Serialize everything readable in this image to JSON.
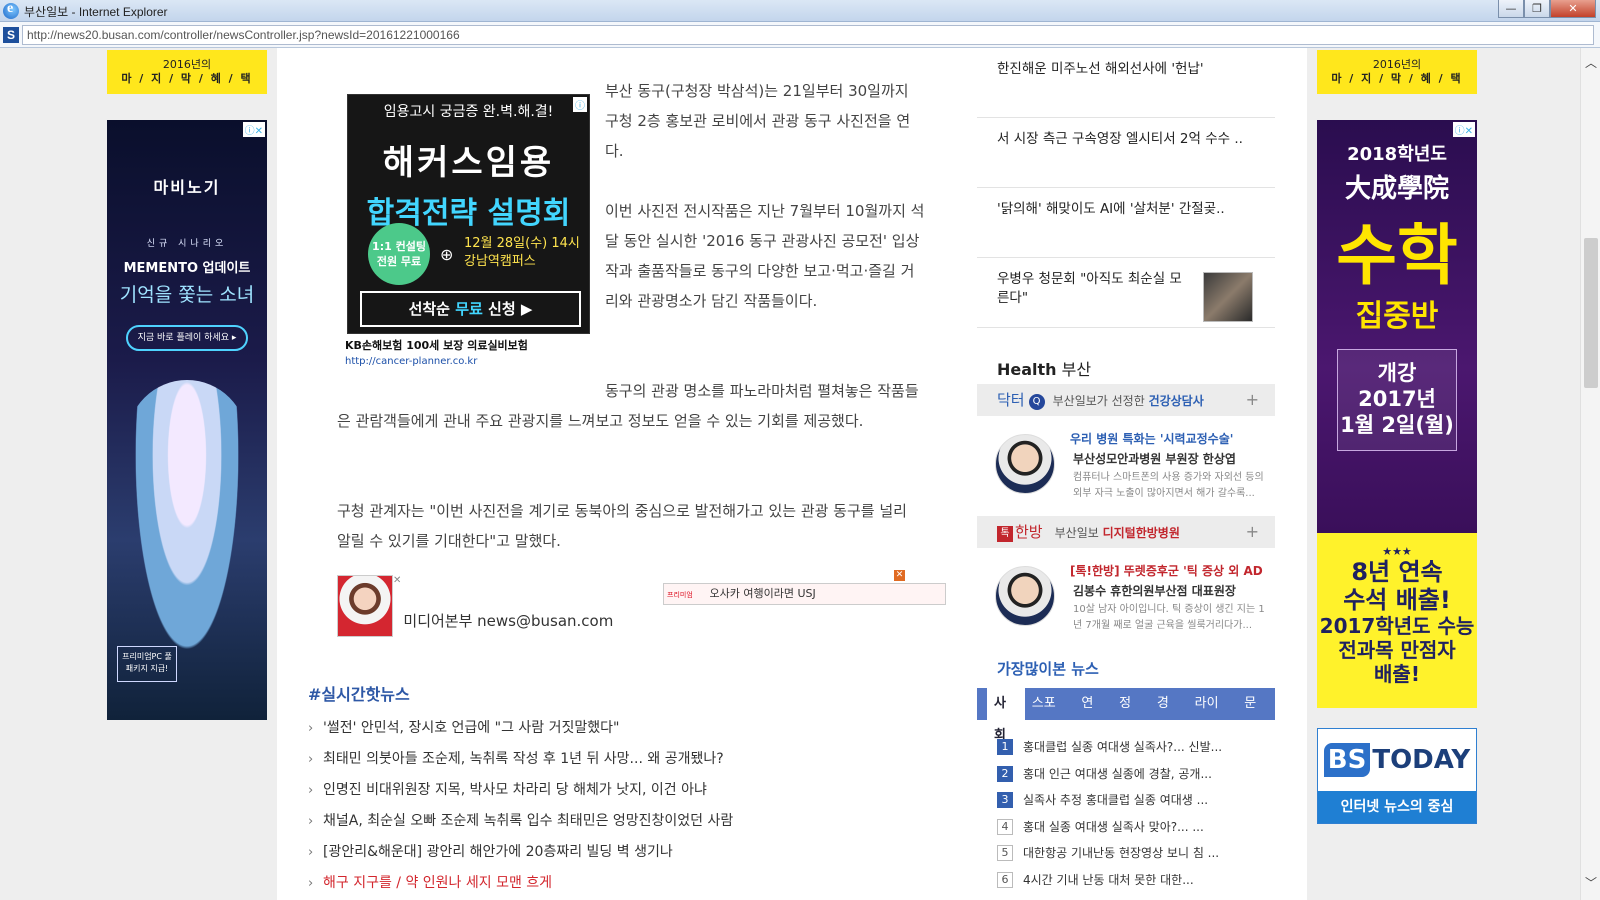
{
  "window": {
    "title": "부산일보 - Internet Explorer",
    "url": "http://news20.busan.com/controller/newsController.jsp?newsId=20161221000166",
    "buttons": {
      "minimize": "—",
      "maximize": "❐",
      "close": "✕"
    }
  },
  "side_banner": {
    "line1": "2016년의",
    "line2": "마 / 지 / 막 / 혜 / 택"
  },
  "ad_left": {
    "logo": "마비노기",
    "line1": "신규 시나리오",
    "line2": "MEMENTO 업데이트",
    "line3": "기억을 쫓는 소녀",
    "button": "지금 바로 플레이 하세요 ▸",
    "pc": "프리미엄PC 풀 패키지 지급!"
  },
  "ad_right": {
    "year": "2018학년도",
    "brand": "大成學院",
    "big": "수학",
    "sub": "집중반",
    "box": [
      "개강",
      "2017년",
      "1월 2일(월)"
    ],
    "stars": "★★★",
    "promo1": "8년 연속",
    "promo2": "수석 배출!",
    "promo3": "2017학년도 수능",
    "promo4": "전과목 만점자",
    "promo5": "배출!"
  },
  "bstoday": {
    "logo": "TODAY",
    "logo_prefix": "BS",
    "caption": "인터넷 뉴스의 중심"
  },
  "inner_ad": {
    "headline": "임용고시 궁금증 완.벽.해.결!",
    "title1": "해커스임용",
    "title2": "합격전략 설명회",
    "circle": "1:1 컨설팅 전원 무료",
    "date1": "12월 28일(수) 14시",
    "date2": "강남역캠퍼스",
    "cta_prefix": "선착순 ",
    "cta_highlight": "무료",
    "cta_suffix": " 신청 ▶",
    "caption": "KB손해보험 100세 보장 의료실비보험",
    "url": "http://cancer-planner.co.kr"
  },
  "article": {
    "p1": "부산 동구(구청장 박삼석)는 21일부터 30일까지 구청 2층 홍보관 로비에서 관광 동구 사진전을 연다.",
    "p2": "이번 사진전 전시작품은 지난 7월부터 10월까지 석 달 동안 실시한 '2016 동구 관광사진 공모전' 입상작과 출품작들로 동구의 다양한 보고·먹고·즐길 거리와 관광명소가 담긴 작품들이다.",
    "p3": "동구의 관광 명소를 파노라마처럼 펼쳐놓은 작품들은 관람객들에게 관내 주요 관광지를 느껴보고 정보도 얻을 수 있는 기회를 제공했다.",
    "p4": "구청 관계자는 \"이번 사진전을 계기로 동북아의 중심으로 발전해가고 있는 관광 동구를 널리 알릴 수 있기를 기대한다\"고 말했다.",
    "byline": "미디어본부 news@busan.com",
    "usj_tag": "프리미엄",
    "usj_text": "오사카 여행이라면 USJ"
  },
  "hot_news": {
    "title": "#실시간핫뉴스",
    "items": [
      "'썰전' 안민석, 장시호 언급에 \"그 사람 거짓말했다\"",
      "최태민 의붓아들 조순제, 녹취록 작성 후 1년 뒤 사망... 왜 공개됐나?",
      "인명진 비대위원장 지목, 박사모 차라리 당 해체가 낫지, 이건 아냐",
      "채널A, 최순실 오빠 조순제 녹취록 입수 최태민은 엉망진창이었던 사람",
      "[광안리&해운대] 광안리 해안가에 20층짜리 빌딩 벽 생기나",
      "해구 지구를 / 약 인원나 세지 모맨 흐게"
    ]
  },
  "sidebar_news": [
    "한진해운 미주노선 해외선사에 '헌납'",
    "서 시장 측근 구속영장 엘시티서 2억 수수 ..",
    "'닭의해' 해맞이도 AI에 '살처분' 간절곶..",
    "우병우 청문회 \"아직도 최순실 모른다\""
  ],
  "health": {
    "title_bold": "Health",
    "title_rest": " 부산",
    "bar1": {
      "label": "닥터",
      "icon": "Q",
      "text": "부산일보가 선정한 ",
      "highlight": "건강상담사",
      "plus": "+"
    },
    "doctor1": {
      "title": "우리 병원 특화는 '시력교정수술'",
      "name": "부산성모안과병원 부원장 한상엽",
      "desc": "컴퓨터나 스마트폰의 사용 증가와 자외선 등의 외부 자극 노출이 많아지면서 해가 갈수록..."
    },
    "bar2": {
      "icon": "톡",
      "label": "한방",
      "text": "부산일보 ",
      "highlight": "디지털한방병원",
      "plus": "+"
    },
    "doctor2": {
      "title": "[톡!한방] 뚜렛증후군 '틱 증상 외 AD",
      "name": "김봉수 휴한의원부산점 대표원장",
      "desc": "10살 남자 아이입니다. 틱 증상이 생긴 지는 1년 7개월 째로 얼굴 근육을 씰룩거리다가..."
    }
  },
  "most_viewed": {
    "title": "가장많이본 뉴스",
    "tabs": [
      "사회",
      "스포츠",
      "연예",
      "정치",
      "경제",
      "라이프",
      "문화"
    ],
    "items": [
      {
        "rank": "1",
        "text": "홍대클럽 실종 여대생 실족사?... 신발..."
      },
      {
        "rank": "2",
        "text": "홍대 인근 여대생 실종에 경찰, 공개..."
      },
      {
        "rank": "3",
        "text": "실족사 추정 홍대클럽 실종 여대생 ..."
      },
      {
        "rank": "4",
        "text": "홍대 실종 여대생 실족사 맞아?... ..."
      },
      {
        "rank": "5",
        "text": "대한항공 기내난동 현장영상 보니 침 ..."
      },
      {
        "rank": "6",
        "text": "4시간 기내 난동 대처 못한 대한..."
      }
    ]
  }
}
